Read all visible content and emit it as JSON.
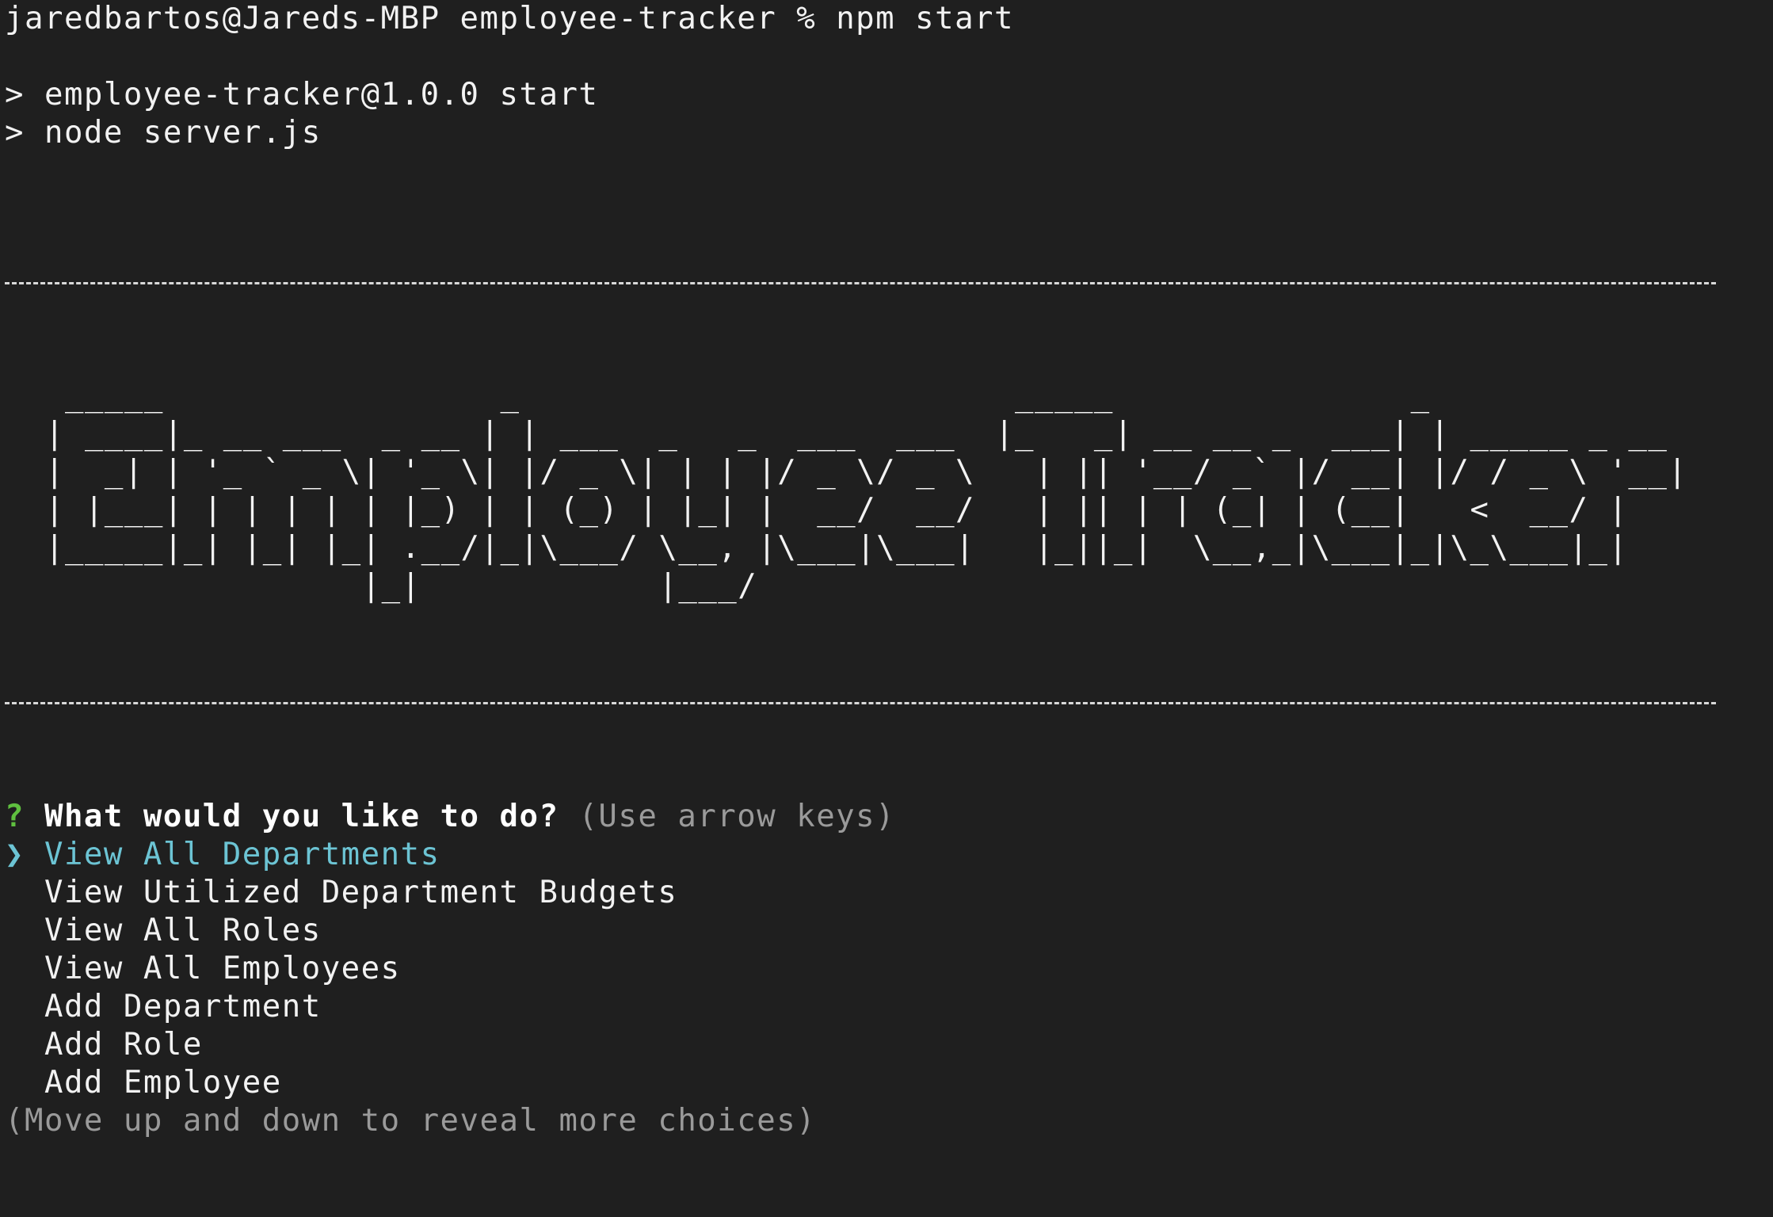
{
  "prompt": {
    "user_host": "jaredbartos@Jareds-MBP",
    "cwd": "employee-tracker",
    "symbol": "%",
    "command": "npm start"
  },
  "npm_output": [
    "> employee-tracker@1.0.0 start",
    "> node server.js"
  ],
  "banner_ascii": "  _____                 _                         _____               _\n | ____|_ __ ___  _ __ | | ___  _   _  ___  ___  |_   _| __ __ _  ___| | _____ _ __\n |  _| | '_ ` _ \\| '_ \\| |/ _ \\| | | |/ _ \\/ _ \\   | || '__/ _` |/ __| |/ / _ \\ '__|\n | |___| | | | | | |_) | | (_) | |_| |  __/  __/   | || | | (_| | (__|   <  __/ |\n |_____|_| |_| |_| .__/|_|\\___/ \\__, |\\___|\\___|   |_||_|  \\__,_|\\___|_|\\_\\___|_|\n                 |_|            |___/",
  "question": {
    "mark": "?",
    "text": "What would you like to do?",
    "hint": "(Use arrow keys)"
  },
  "menu": {
    "pointer": "❯",
    "selected": "View All Departments",
    "choices": [
      "View Utilized Department Budgets",
      "View All Roles",
      "View All Employees",
      "Add Department",
      "Add Role",
      "Add Employee"
    ],
    "footer": "(Move up and down to reveal more choices)"
  },
  "colors": {
    "background": "#1f1f1f",
    "text": "#f2f2f2",
    "question_mark": "#5fbf3f",
    "highlight": "#6cc4d4",
    "hint": "#9a9a9a"
  }
}
